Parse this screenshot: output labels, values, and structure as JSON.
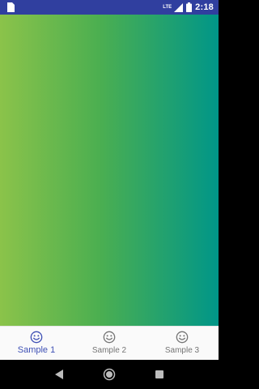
{
  "status_bar": {
    "time": "2:18",
    "network_label": "LTE",
    "icons": [
      "sim-card-icon",
      "signal-icon",
      "battery-icon"
    ],
    "background": "#303F9F"
  },
  "content": {
    "gradient_colors": [
      "#8BC34A",
      "#4CAF50",
      "#009688"
    ]
  },
  "bottom_nav": {
    "items": [
      {
        "label": "Sample 1",
        "icon": "smiley-icon",
        "active": true
      },
      {
        "label": "Sample 2",
        "icon": "smiley-icon",
        "active": false
      },
      {
        "label": "Sample 3",
        "icon": "smiley-icon",
        "active": false
      }
    ],
    "active_color": "#3F51B5",
    "inactive_color": "#757575"
  },
  "system_nav": {
    "buttons": [
      "back-icon",
      "home-icon",
      "recents-icon"
    ]
  }
}
